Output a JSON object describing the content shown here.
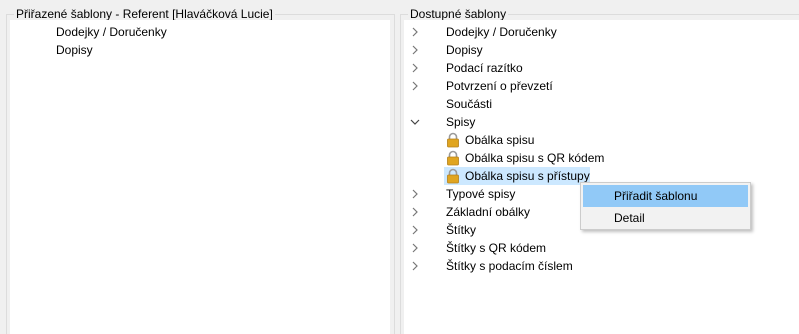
{
  "left_panel": {
    "title": "Přiřazené šablony - Referent [Hlaváčková Lucie]",
    "items": [
      {
        "label": "Dodejky / Doručenky"
      },
      {
        "label": "Dopisy"
      }
    ]
  },
  "right_panel": {
    "title": "Dostupné šablony",
    "items": [
      {
        "label": "Dodejky / Doručenky",
        "state": "collapsed"
      },
      {
        "label": "Dopisy",
        "state": "collapsed"
      },
      {
        "label": "Podací razítko",
        "state": "collapsed"
      },
      {
        "label": "Potvrzení o převzetí",
        "state": "collapsed"
      },
      {
        "label": "Součásti",
        "state": "leaf"
      },
      {
        "label": "Spisy",
        "state": "expanded"
      },
      {
        "label": "Obálka spisu",
        "icon": "lock-icon"
      },
      {
        "label": "Obálka spisu s QR kódem",
        "icon": "lock-icon"
      },
      {
        "label": "Obálka spisu s přístupy",
        "icon": "lock-icon",
        "selected": true
      },
      {
        "label": "Typové spisy",
        "state": "collapsed"
      },
      {
        "label": "Základní obálky",
        "state": "collapsed"
      },
      {
        "label": "Štítky",
        "state": "collapsed"
      },
      {
        "label": "Štítky s QR kódem",
        "state": "collapsed"
      },
      {
        "label": "Štítky s podacím číslem",
        "state": "collapsed"
      }
    ]
  },
  "context_menu": {
    "items": [
      {
        "label": "Přiřadit šablonu",
        "highlighted": true
      },
      {
        "label": "Detail"
      }
    ]
  },
  "colors": {
    "selection": "#cce8ff",
    "menu_highlight": "#91c9f7",
    "lock": "#e0a520"
  }
}
